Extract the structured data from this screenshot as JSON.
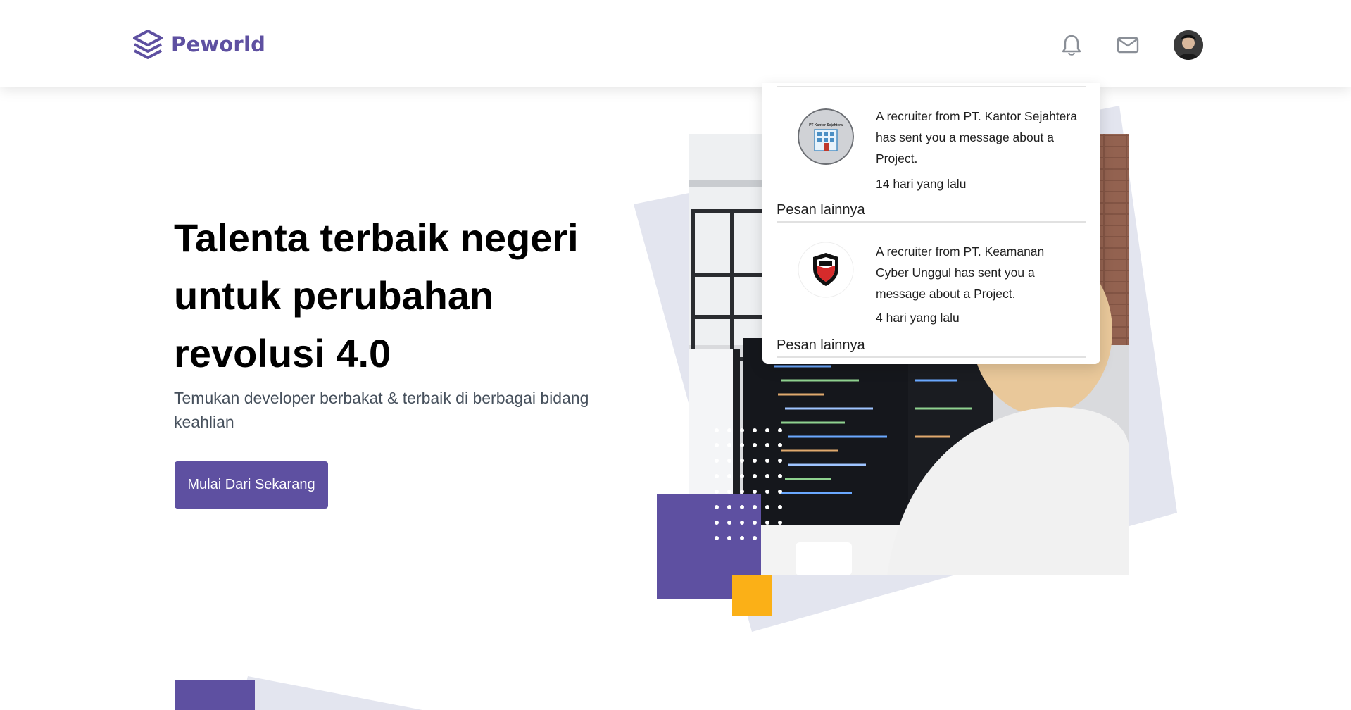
{
  "brand": {
    "name": "Peworld"
  },
  "nav": {
    "icons": [
      "bell-icon",
      "mail-icon"
    ],
    "accent": "#5e50a1"
  },
  "hero": {
    "title": "Talenta terbaik negeri untuk perubahan revolusi 4.0",
    "subtitle": "Temukan developer berbakat & terbaik di berbagai bidang keahlian",
    "cta_label": "Mulai Dari Sekarang"
  },
  "notifications": [
    {
      "message": "A recruiter from PT. Kantor Sejahtera has sent you a message about a Project.",
      "time": "14 hari yang lalu",
      "more_label": "Pesan lainnya",
      "logo_text": "PT Kantor Sejahtera"
    },
    {
      "message": "A recruiter from PT. Keamanan Cyber Unggul has sent you a message about a Project.",
      "time": "4 hari yang lalu",
      "more_label": "Pesan lainnya"
    }
  ],
  "colors": {
    "primary": "#5e50a1",
    "yellow": "#fbb017",
    "decor_gray": "#e3e5ef"
  }
}
